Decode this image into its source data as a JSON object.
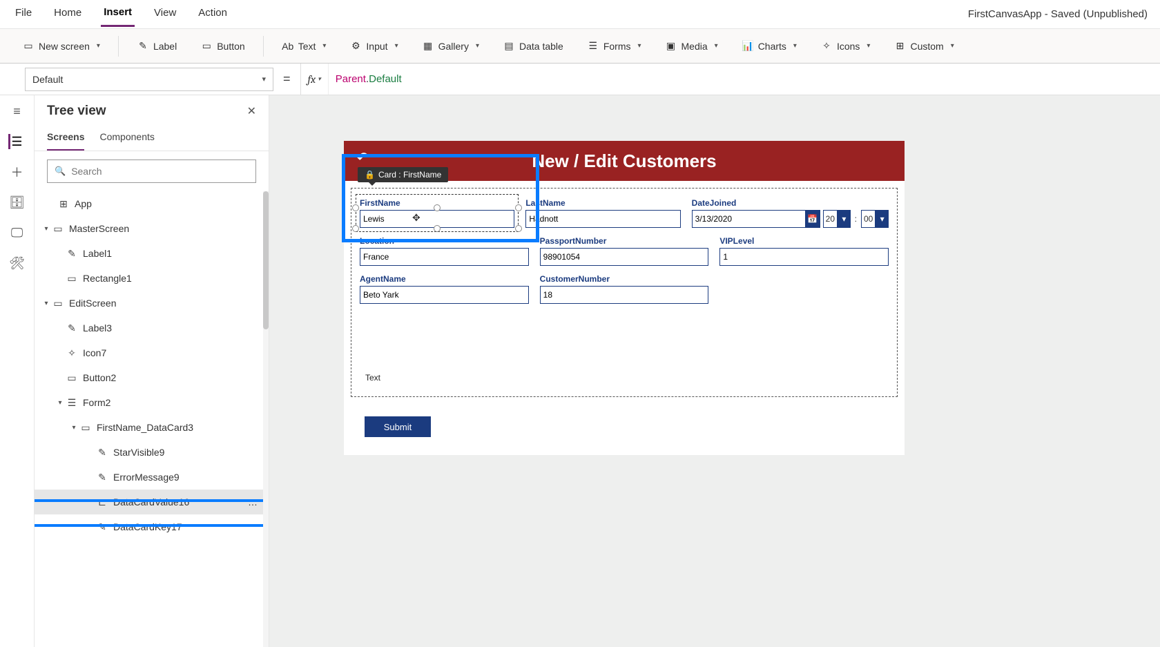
{
  "doc_title": "FirstCanvasApp - Saved (Unpublished)",
  "menu": {
    "file": "File",
    "home": "Home",
    "insert": "Insert",
    "view": "View",
    "action": "Action"
  },
  "ribbon": {
    "new_screen": "New screen",
    "label": "Label",
    "button": "Button",
    "text": "Text",
    "input": "Input",
    "gallery": "Gallery",
    "data_table": "Data table",
    "forms": "Forms",
    "media": "Media",
    "charts": "Charts",
    "icons": "Icons",
    "custom": "Custom"
  },
  "formula": {
    "property": "Default",
    "fx": "fx",
    "object": "Parent",
    "prop": "Default"
  },
  "treepanel": {
    "title": "Tree view",
    "tabs": {
      "screens": "Screens",
      "components": "Components"
    },
    "search_placeholder": "Search"
  },
  "tree": {
    "app": "App",
    "masterscreen": "MasterScreen",
    "label1": "Label1",
    "rectangle1": "Rectangle1",
    "editscreen": "EditScreen",
    "label3": "Label3",
    "icon7": "Icon7",
    "button2": "Button2",
    "form2": "Form2",
    "firstname_card": "FirstName_DataCard3",
    "starvisible9": "StarVisible9",
    "errormessage9": "ErrorMessage9",
    "datacardvalue16": "DataCardValue16",
    "datacardkey17": "DataCardKey17",
    "more": "…"
  },
  "canvas": {
    "tooltip": "Card : FirstName",
    "header_title": "New / Edit Customers",
    "fields": {
      "firstname_label": "FirstName",
      "firstname_val": "Lewis",
      "lastname_label": "LastName",
      "lastname_val": "Hadnott",
      "datejoined_label": "DateJoined",
      "datejoined_val": "3/13/2020",
      "hour": "20",
      "min": "00",
      "location_label": "Location",
      "location_val": "France",
      "passport_label": "PassportNumber",
      "passport_val": "98901054",
      "vip_label": "VIPLevel",
      "vip_val": "1",
      "agent_label": "AgentName",
      "agent_val": "Beto Yark",
      "custnum_label": "CustomerNumber",
      "custnum_val": "18"
    },
    "text_placeholder": "Text",
    "submit": "Submit"
  }
}
